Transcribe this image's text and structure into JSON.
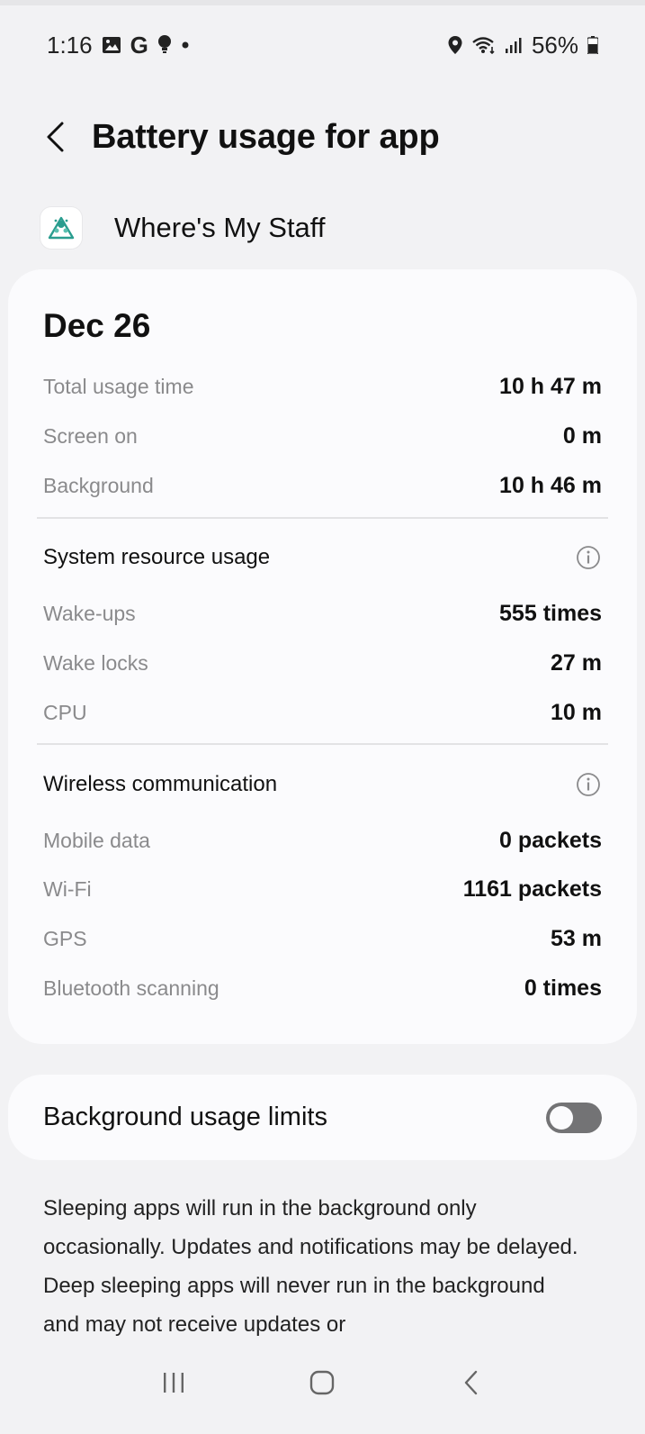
{
  "status_bar": {
    "time": "1:16",
    "battery": "56%",
    "icons": [
      "gallery-icon",
      "google-icon",
      "bulb-icon",
      "dot-icon",
      "location-icon",
      "wifi-icon",
      "signal-icon",
      "battery-icon"
    ]
  },
  "header": {
    "title": "Battery usage for app"
  },
  "app": {
    "name": "Where's My Staff",
    "icon": "app-icon"
  },
  "usage": {
    "date": "Dec 26",
    "rows": [
      {
        "label": "Total usage time",
        "value": "10 h 47 m"
      },
      {
        "label": "Screen on",
        "value": "0 m"
      },
      {
        "label": "Background",
        "value": "10 h 46 m"
      }
    ],
    "system": {
      "title": "System resource usage",
      "rows": [
        {
          "label": "Wake-ups",
          "value": "555 times"
        },
        {
          "label": "Wake locks",
          "value": "27 m"
        },
        {
          "label": "CPU",
          "value": "10 m"
        }
      ]
    },
    "wireless": {
      "title": "Wireless communication",
      "rows": [
        {
          "label": "Mobile data",
          "value": "0 packets"
        },
        {
          "label": "Wi-Fi",
          "value": "1161 packets"
        },
        {
          "label": "GPS",
          "value": "53 m"
        },
        {
          "label": "Bluetooth scanning",
          "value": "0 times"
        }
      ]
    }
  },
  "background_limits": {
    "label": "Background usage limits",
    "enabled": false
  },
  "description": "Sleeping apps will run in the background only occasionally. Updates and notifications may be delayed. Deep sleeping apps will never run in the background and may not receive updates or",
  "colors": {
    "background": "#f2f2f4",
    "card": "#fbfbfd",
    "label_grey": "#8a8a8c",
    "toggle_off": "#737375"
  }
}
